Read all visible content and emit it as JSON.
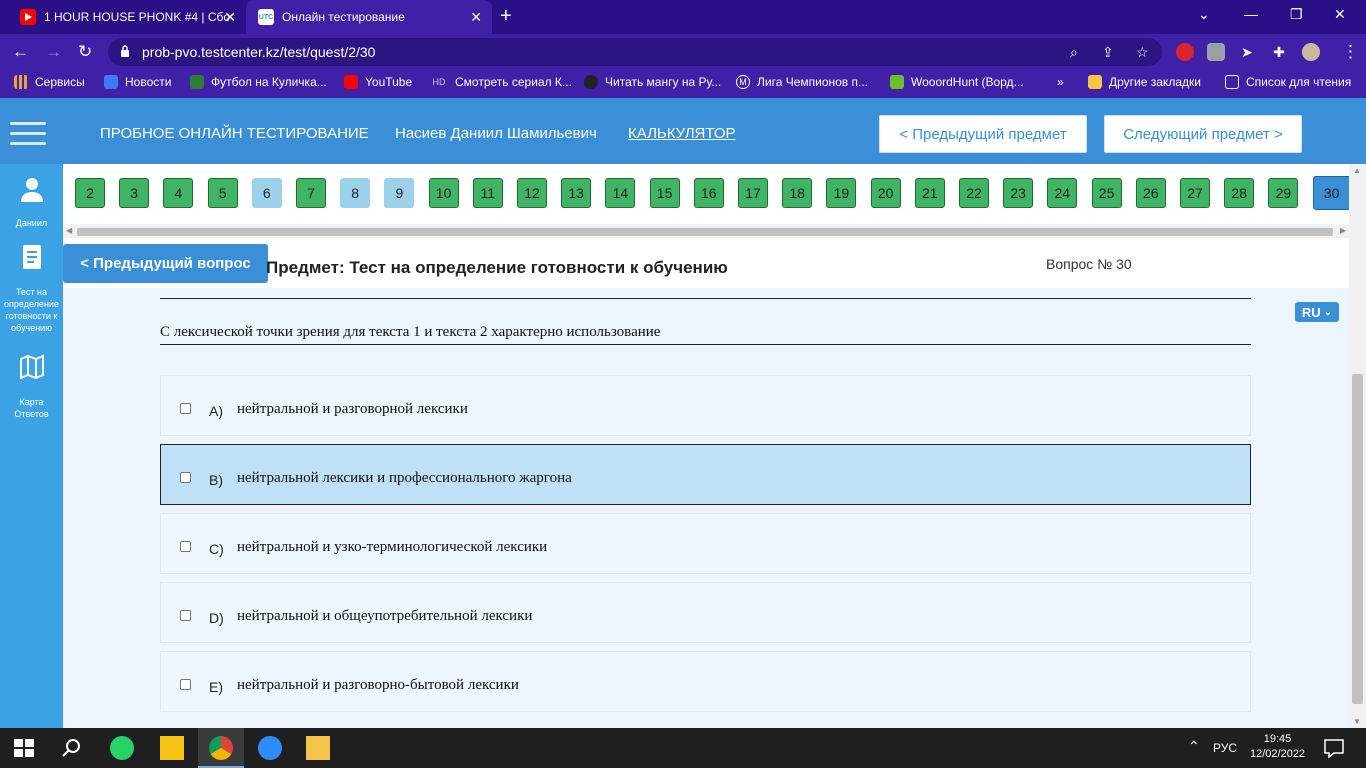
{
  "browser": {
    "tabs": [
      {
        "title": "1 HOUR HOUSE PHONK #4 | Сбо",
        "icon": "youtube-icon"
      },
      {
        "title": "Онлайн тестирование",
        "icon": "testcenter-icon"
      }
    ],
    "url": "prob-pvo.testcenter.kz/test/quest/2/30",
    "bookmarks": [
      {
        "label": "Сервисы",
        "icon": "apps-icon"
      },
      {
        "label": "Новости",
        "icon": "news-icon"
      },
      {
        "label": "Футбол на Куличка...",
        "icon": "football-icon"
      },
      {
        "label": "YouTube",
        "icon": "youtube-icon"
      },
      {
        "label": "Смотреть сериал К...",
        "icon": "hd-icon"
      },
      {
        "label": "Читать мангу на Ру...",
        "icon": "manga-icon"
      },
      {
        "label": "Лига Чемпионов п...",
        "icon": "m-icon"
      },
      {
        "label": "WooordHunt (Ворд...",
        "icon": "wooordhunt-icon"
      }
    ],
    "bookmarks_more": "»",
    "other_bookmarks": "Другие закладки",
    "reading_list": "Список для чтения"
  },
  "header": {
    "title": "ПРОБНОЕ ОНЛАЙН ТЕСТИРОВАНИЕ",
    "user": "Насиев Даниил Шамильевич",
    "calculator": "КАЛЬКУЛЯТОР",
    "prev_subject": "< Предыдущий предмет",
    "next_subject": "Следующий предмет >"
  },
  "sidebar": {
    "user_label": "Даниил",
    "test_label": "Тест на определение готовности к обучению",
    "map_label": "Карта Ответов"
  },
  "questions": [
    {
      "n": "2",
      "state": "answered"
    },
    {
      "n": "3",
      "state": "answered"
    },
    {
      "n": "4",
      "state": "answered"
    },
    {
      "n": "5",
      "state": "answered"
    },
    {
      "n": "6",
      "state": "skipped"
    },
    {
      "n": "7",
      "state": "answered"
    },
    {
      "n": "8",
      "state": "skipped"
    },
    {
      "n": "9",
      "state": "skipped"
    },
    {
      "n": "10",
      "state": "answered"
    },
    {
      "n": "11",
      "state": "answered"
    },
    {
      "n": "12",
      "state": "answered"
    },
    {
      "n": "13",
      "state": "answered"
    },
    {
      "n": "14",
      "state": "answered"
    },
    {
      "n": "15",
      "state": "answered"
    },
    {
      "n": "16",
      "state": "answered"
    },
    {
      "n": "17",
      "state": "answered"
    },
    {
      "n": "18",
      "state": "answered"
    },
    {
      "n": "19",
      "state": "answered"
    },
    {
      "n": "20",
      "state": "answered"
    },
    {
      "n": "21",
      "state": "answered"
    },
    {
      "n": "22",
      "state": "answered"
    },
    {
      "n": "23",
      "state": "answered"
    },
    {
      "n": "24",
      "state": "answered"
    },
    {
      "n": "25",
      "state": "answered"
    },
    {
      "n": "26",
      "state": "answered"
    },
    {
      "n": "27",
      "state": "answered"
    },
    {
      "n": "28",
      "state": "answered"
    },
    {
      "n": "29",
      "state": "answered"
    },
    {
      "n": "30",
      "state": "current"
    }
  ],
  "prev_question": "< Предыдущий вопрос",
  "subject": "Предмет: Тест на определение готовности к обучению",
  "question_number": "Вопрос № 30",
  "language": "RU",
  "question_text": "С лексической точки зрения для текста 1 и текста 2 характерно использование",
  "options": [
    {
      "letter": "A)",
      "text": "нейтральной и разговорной лексики",
      "selected": false
    },
    {
      "letter": "B)",
      "text": "нейтральной лексики и профессионального жаргона",
      "selected": true
    },
    {
      "letter": "C)",
      "text": "нейтральной и узко-терминологической лексики",
      "selected": false
    },
    {
      "letter": "D)",
      "text": "нейтральной и общеупотребительной лексики",
      "selected": false
    },
    {
      "letter": "E)",
      "text": "нейтральной и разговорно-бытовой лексики",
      "selected": false
    }
  ],
  "taskbar": {
    "lang": "РУС",
    "time": "19:45",
    "date": "12/02/2022"
  },
  "colors": {
    "answered": "#3fb465",
    "skipped": "#9cd1ec",
    "current": "#3b8fd6",
    "header": "#3b8fd6"
  }
}
